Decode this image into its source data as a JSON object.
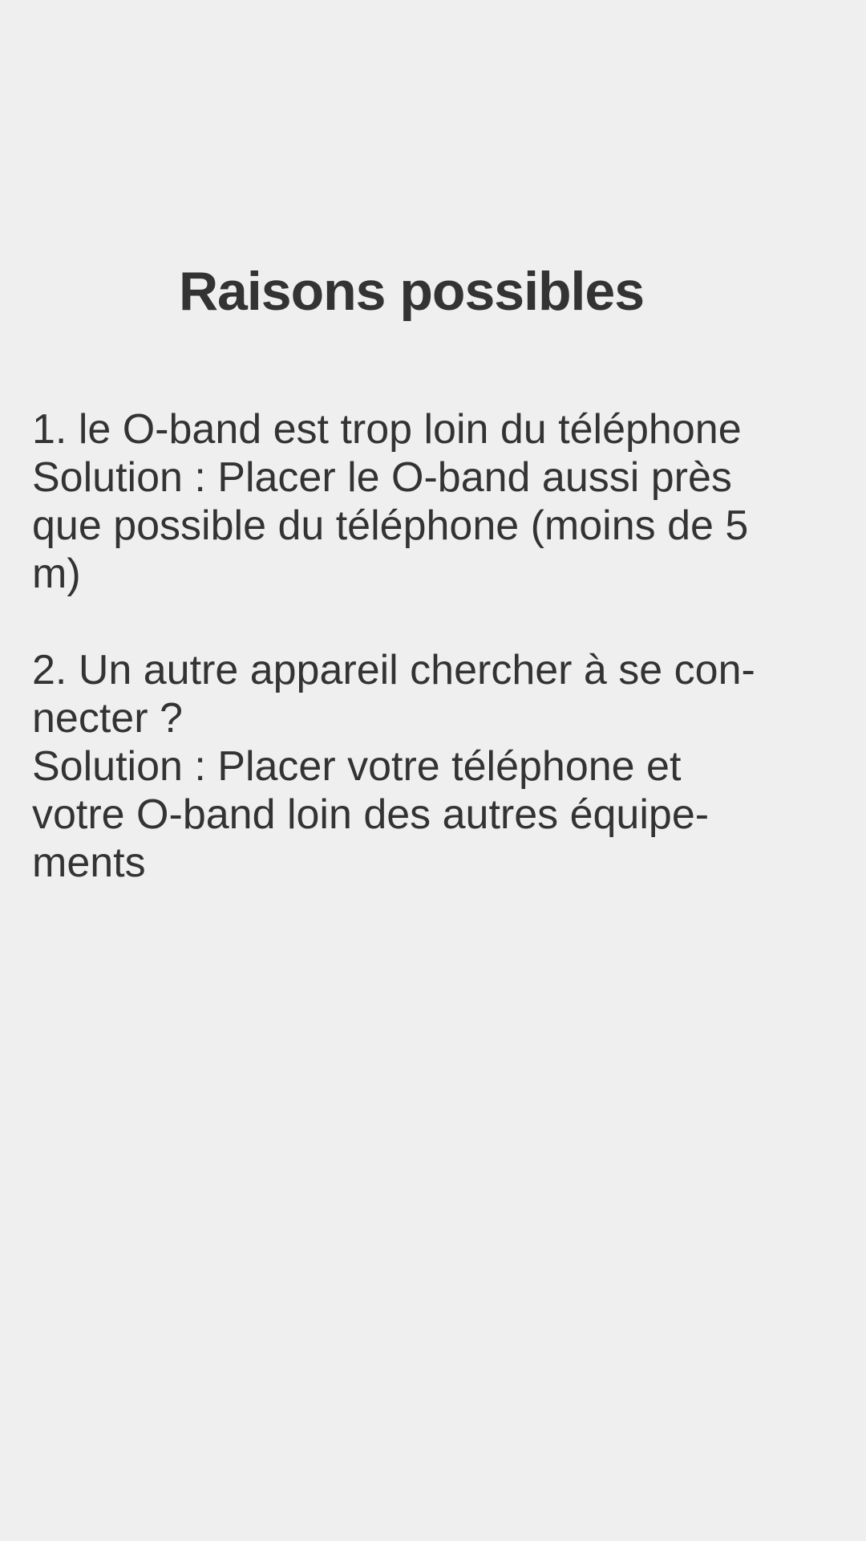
{
  "title": "Raisons possibles",
  "reasons": [
    {
      "lines": [
        "1. le O-band est trop loin du téléphone",
        "Solution : Placer le O-band aussi près",
        "que possible du téléphone (moins de 5",
        "m)"
      ]
    },
    {
      "lines": [
        "2. Un autre appareil chercher à se con-",
        "necter ?",
        "Solution : Placer votre téléphone et",
        "votre O-band loin des autres équipe-",
        "ments"
      ]
    }
  ]
}
